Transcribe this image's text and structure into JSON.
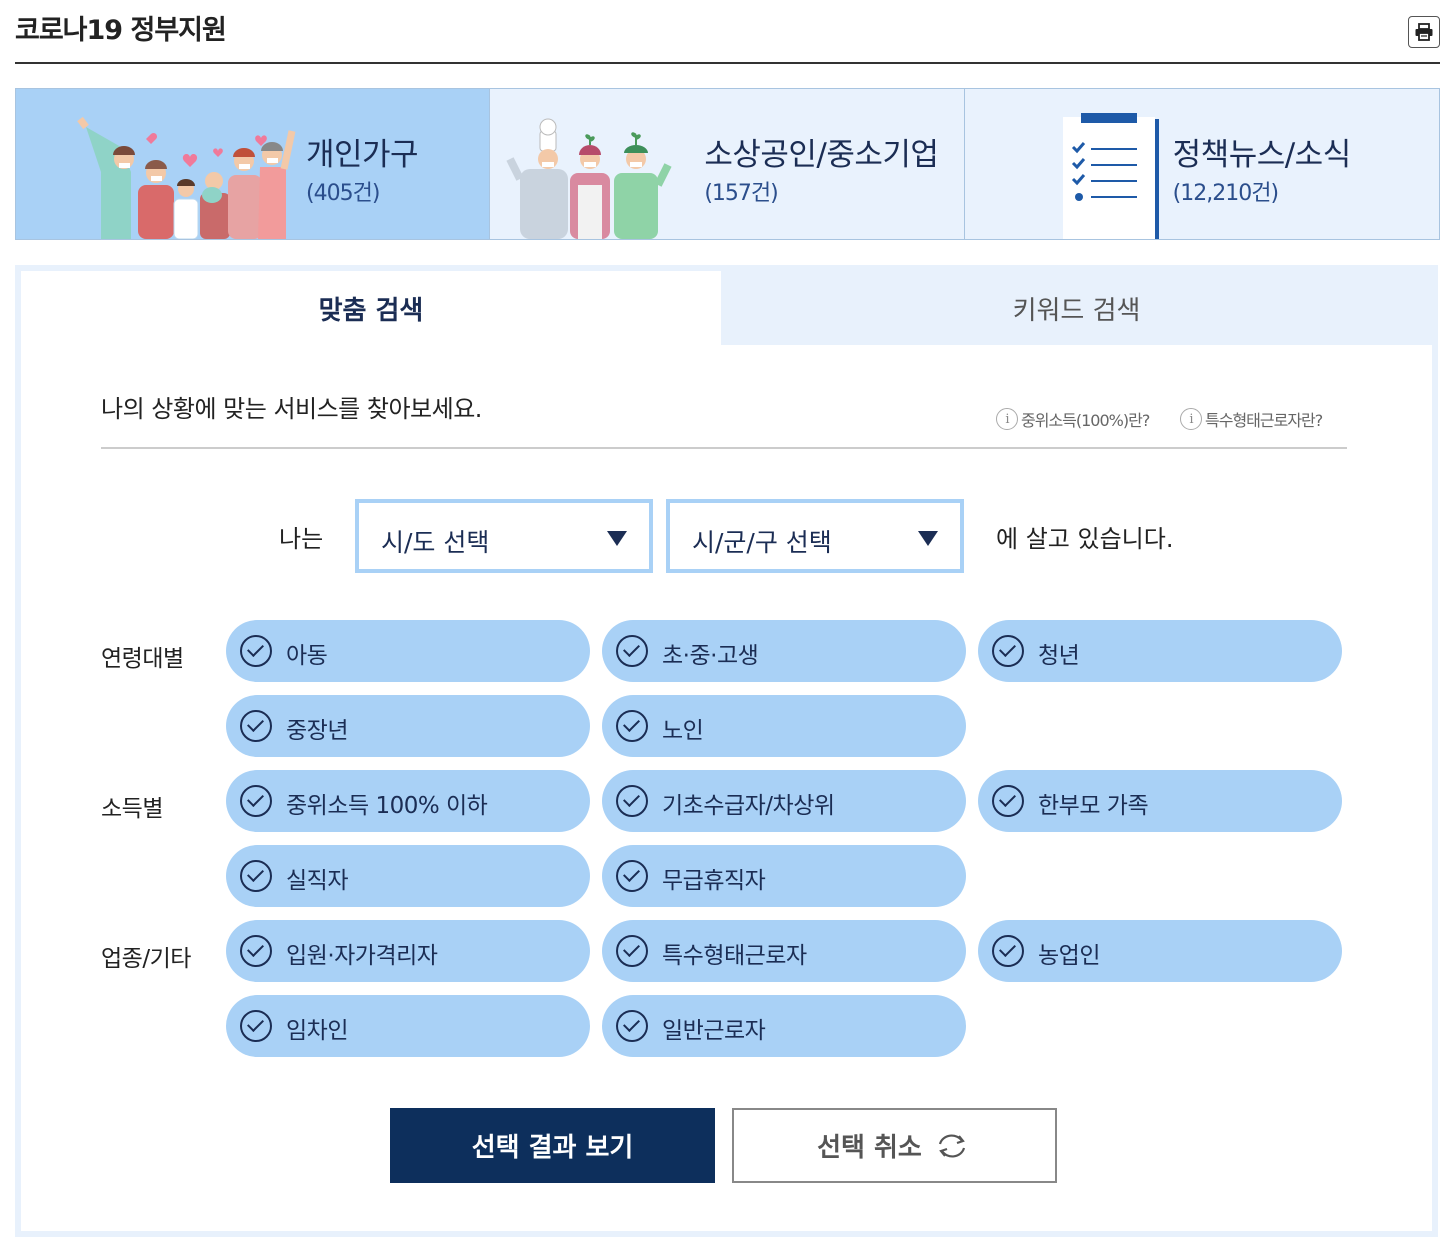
{
  "page": {
    "title": "코로나19 정부지원",
    "print_icon": "print-icon"
  },
  "categories": [
    {
      "label": "개인가구",
      "count": "(405건)",
      "icon": "family-illustration",
      "active": true
    },
    {
      "label": "소상공인/중소기업",
      "count": "(157건)",
      "icon": "shopkeepers-illustration",
      "active": false
    },
    {
      "label": "정책뉴스/소식",
      "count": "(12,210건)",
      "icon": "checklist-illustration",
      "active": false
    }
  ],
  "tabs": [
    {
      "label": "맞춤 검색",
      "active": true
    },
    {
      "label": "키워드 검색",
      "active": false
    }
  ],
  "search": {
    "intro": "나의 상황에 맞는 서비스를 찾아보세요.",
    "help_links": [
      "중위소득(100%)란?",
      "특수형태근로자란?"
    ],
    "live_prefix": "나는",
    "live_suffix": "에 살고 있습니다.",
    "select_province": "시/도 선택",
    "select_district": "시/군/구 선택"
  },
  "groups": [
    {
      "label": "연령대별",
      "items": [
        "아동",
        "초·중·고생",
        "청년",
        "중장년",
        "노인"
      ]
    },
    {
      "label": "소득별",
      "items": [
        "중위소득 100% 이하",
        "기초수급자/차상위",
        "한부모 가족",
        "실직자",
        "무급휴직자"
      ]
    },
    {
      "label": "업종/기타",
      "items": [
        "입원·자가격리자",
        "특수형태근로자",
        "농업인",
        "임차인",
        "일반근로자"
      ]
    }
  ],
  "buttons": {
    "submit": "선택 결과 보기",
    "reset": "선택 취소"
  },
  "colors": {
    "navy": "#0d2f5c",
    "chip": "#a9d1f6",
    "panel": "#e8f1fc",
    "text_dark": "#1b2d54"
  }
}
